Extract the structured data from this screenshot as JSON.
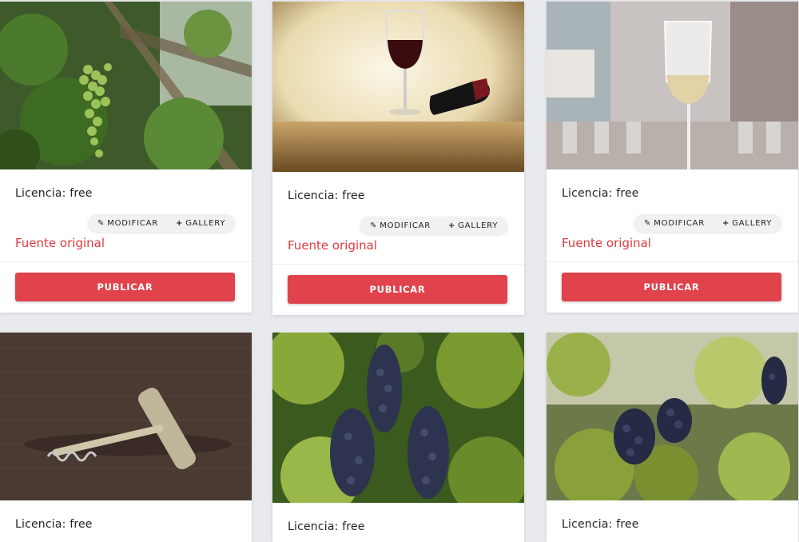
{
  "cards": [
    {
      "image": "grapevine-green-grapes",
      "license": "Licencia: free",
      "modify": "MODIFICAR",
      "gallery": "GALLERY",
      "source": "Fuente original",
      "publish": "PUBLICAR"
    },
    {
      "image": "red-wine-glass-bottle",
      "license": "Licencia: free",
      "modify": "MODIFICAR",
      "gallery": "GALLERY",
      "source": "Fuente original",
      "publish": "PUBLICAR"
    },
    {
      "image": "white-wine-glass",
      "license": "Licencia: free",
      "modify": "MODIFICAR",
      "gallery": "GALLERY",
      "source": "Fuente original",
      "publish": "PUBLICAR"
    },
    {
      "image": "corkscrew",
      "license": "Licencia: free"
    },
    {
      "image": "red-grapes-vine",
      "license": "Licencia: free"
    },
    {
      "image": "vineyard-grapes",
      "license": "Licencia: free"
    }
  ],
  "icons": {
    "modify": "pencil-icon",
    "gallery": "plus-icon"
  },
  "colors": {
    "accent": "#e0434b",
    "source_link": "#e03a3f",
    "background": "#e9eaee"
  }
}
